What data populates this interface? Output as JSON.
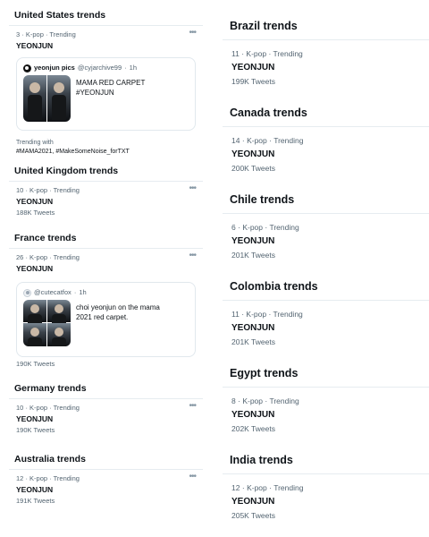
{
  "left": {
    "us": {
      "title": "United States trends",
      "rank": "3",
      "category": "K-pop",
      "trending": "Trending",
      "name": "YEONJUN",
      "card": {
        "author": "yeonjun pics",
        "handle": "@cyjarchive99",
        "time": "1h",
        "text_line1": "MAMA RED CARPET",
        "text_line2": "#YEONJUN"
      },
      "trending_with_label": "Trending with",
      "trending_with_tags": "#MAMA2021, #MakeSomeNoise_forTXT"
    },
    "uk": {
      "title": "United Kingdom trends",
      "rank": "10",
      "category": "K-pop",
      "trending": "Trending",
      "name": "YEONJUN",
      "count": "188K Tweets"
    },
    "fr": {
      "title": "France trends",
      "rank": "26",
      "category": "K-pop",
      "trending": "Trending",
      "name": "YEONJUN",
      "card": {
        "handle": "@cutecatfox",
        "time": "1h",
        "text_line1": "choi yeonjun on the mama",
        "text_line2": "2021 red carpet."
      },
      "count": "190K Tweets"
    },
    "de": {
      "title": "Germany trends",
      "rank": "10",
      "category": "K-pop",
      "trending": "Trending",
      "name": "YEONJUN",
      "count": "190K Tweets"
    },
    "au": {
      "title": "Australia trends",
      "rank": "12",
      "category": "K-pop",
      "trending": "Trending",
      "name": "YEONJUN",
      "count": "191K Tweets"
    }
  },
  "right": {
    "br": {
      "title": "Brazil trends",
      "rank": "11",
      "category": "K-pop",
      "trending": "Trending",
      "name": "YEONJUN",
      "count": "199K Tweets"
    },
    "ca": {
      "title": "Canada trends",
      "rank": "14",
      "category": "K-pop",
      "trending": "Trending",
      "name": "YEONJUN",
      "count": "200K Tweets"
    },
    "cl": {
      "title": "Chile trends",
      "rank": "6",
      "category": "K-pop",
      "trending": "Trending",
      "name": "YEONJUN",
      "count": "201K Tweets"
    },
    "co": {
      "title": "Colombia trends",
      "rank": "11",
      "category": "K-pop",
      "trending": "Trending",
      "name": "YEONJUN",
      "count": "201K Tweets"
    },
    "eg": {
      "title": "Egypt trends",
      "rank": "8",
      "category": "K-pop",
      "trending": "Trending",
      "name": "YEONJUN",
      "count": "202K Tweets"
    },
    "in": {
      "title": "India trends",
      "rank": "12",
      "category": "K-pop",
      "trending": "Trending",
      "name": "YEONJUN",
      "count": "205K Tweets"
    }
  },
  "separator": "·",
  "more_icon": "more-dots-icon"
}
